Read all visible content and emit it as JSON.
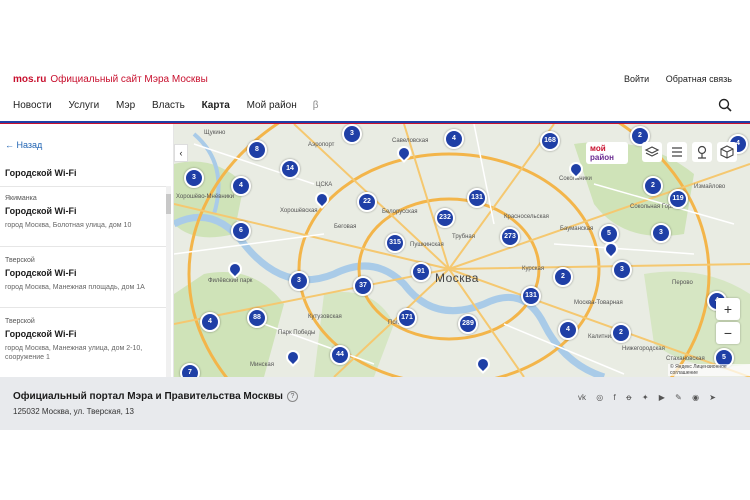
{
  "header": {
    "brand_site": "mos.ru",
    "brand_text": "Официальный сайт Мэра Москвы",
    "login": "Войти",
    "feedback": "Обратная связь",
    "nav": [
      "Новости",
      "Услуги",
      "Мэр",
      "Власть",
      "Карта",
      "Мой район"
    ],
    "nav_beta": "β",
    "active_nav": "Карта"
  },
  "panel": {
    "back": "Назад",
    "title": "Городской Wi-Fi",
    "items": [
      {
        "district": "Якиманка",
        "name": "Городской Wi-Fi",
        "address": "город Москва, Болотная улица, дом 10"
      },
      {
        "district": "Тверской",
        "name": "Городской Wi-Fi",
        "address": "город Москва, Манежная площадь, дом 1А"
      },
      {
        "district": "Тверской",
        "name": "Городской Wi-Fi",
        "address": "город Москва, Манежная улица, дом 2-10, сооружение 1"
      }
    ]
  },
  "map": {
    "city": "Москва",
    "moi_raion_line1": "мой",
    "moi_raion_line2": "район",
    "clusters": [
      "3",
      "4",
      "168",
      "2",
      "4",
      "8",
      "14",
      "3",
      "4",
      "2",
      "22",
      "232",
      "131",
      "119",
      "6",
      "315",
      "273",
      "5",
      "3",
      "3",
      "91",
      "2",
      "3",
      "37",
      "131",
      "4",
      "88",
      "171",
      "289",
      "4",
      "2",
      "4",
      "44",
      "7",
      "5"
    ],
    "streets": [
      "Щукино",
      "Аэропорт",
      "Савеловская",
      "Сокольники",
      "Измайлово",
      "Хорошёво-Мнёвники",
      "ЦСКА",
      "Хорошёвская",
      "Беговая",
      "Белорусская",
      "Пушкинская",
      "Трубная",
      "Красносельская",
      "Бауманская",
      "Сокольная Гора",
      "Филёвский парк",
      "Кутузовская",
      "Курская",
      "Москва-Товарная",
      "Перово",
      "Парк Победы",
      "Полянка",
      "Калитник",
      "Нижегородская",
      "Минская",
      "Стахановская"
    ],
    "copyright": "© Яндекс Лицензионное соглашение",
    "zoom_in": "+",
    "zoom_out": "−"
  },
  "footer": {
    "title": "Официальный портал Мэра и Правительства Москвы",
    "help": "?",
    "address": "125032 Москва, ул. Тверская, 13",
    "socials": [
      "vk",
      "ok",
      "fb",
      "od",
      "tw",
      "yt",
      "lj",
      "rss",
      "tg"
    ]
  },
  "colors": {
    "accent": "#c8102e",
    "cluster": "#1f3fa6",
    "link": "#1f63b3",
    "footer_bg": "#e8eaed"
  }
}
